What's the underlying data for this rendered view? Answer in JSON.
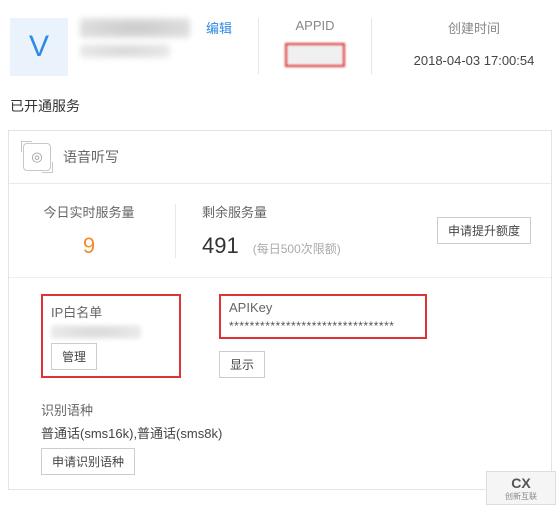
{
  "header": {
    "avatar_letter": "V",
    "edit_label": "编辑",
    "appid_label": "APPID",
    "create_time_label": "创建时间",
    "create_time_value": "2018-04-03 17:00:54"
  },
  "section_title": "已开通服务",
  "service": {
    "icon_glyph": "◎",
    "name": "语音听写"
  },
  "stats": {
    "today_label": "今日实时服务量",
    "today_value": "9",
    "remaining_label": "剩余服务量",
    "remaining_value": "491",
    "remaining_note": "(每日500次限额)",
    "upgrade_button": "申请提升额度"
  },
  "details": {
    "ip_label": "IP白名单",
    "ip_manage_button": "管理",
    "apikey_label": "APIKey",
    "apikey_value": "********************************",
    "apikey_show_button": "显示"
  },
  "lang": {
    "label": "识别语种",
    "value": "普通话(sms16k),普通话(sms8k)",
    "apply_button": "申请识别语种"
  },
  "logo": {
    "main": "CX",
    "sub": "创新互联"
  }
}
